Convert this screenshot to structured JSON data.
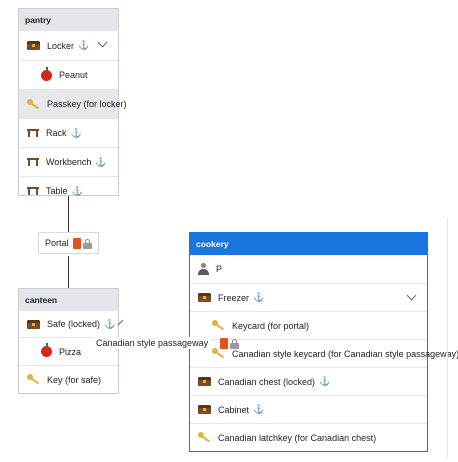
{
  "rooms": {
    "pantry": {
      "title": "pantry",
      "items": [
        {
          "label": "Locker",
          "icon": "chest-icon"
        },
        {
          "label": "Peanut",
          "icon": "apple-icon"
        },
        {
          "label": "Passkey (for locker)",
          "icon": "key-icon"
        },
        {
          "label": "Rack",
          "icon": "table-icon"
        },
        {
          "label": "Workbench",
          "icon": "table-icon"
        },
        {
          "label": "Table",
          "icon": "table-icon"
        }
      ]
    },
    "canteen": {
      "title": "canteen",
      "items": [
        {
          "label": "Safe (locked)",
          "icon": "chest-icon"
        },
        {
          "label": "Pizza",
          "icon": "apple-icon"
        },
        {
          "label": "Key (for safe)",
          "icon": "key-icon"
        }
      ]
    },
    "cookery": {
      "title": "cookery",
      "items": [
        {
          "label": "P",
          "icon": "person-icon"
        },
        {
          "label": "Freezer",
          "icon": "chest-icon"
        },
        {
          "label": "Keycard (for portal)",
          "icon": "key-icon"
        },
        {
          "label": "Canadian style keycard (for Canadian style passageway)",
          "icon": "key-icon"
        },
        {
          "label": "Canadian chest (locked)",
          "icon": "chest-icon"
        },
        {
          "label": "Cabinet",
          "icon": "chest-icon"
        },
        {
          "label": "Canadian latchkey (for Canadian chest)",
          "icon": "key-icon"
        }
      ]
    }
  },
  "connections": {
    "portal": {
      "label": "Portal",
      "icons": [
        "door-icon",
        "lock-icon"
      ]
    },
    "passageway": {
      "label": "Canadian style passageway",
      "icons": [
        "door-icon",
        "lock-icon"
      ]
    }
  },
  "symbols": {
    "anchor": "⚓"
  },
  "colors": {
    "active_header": "#1976e0",
    "inactive_header": "#e2e5ea",
    "highlight_row": "#e6e8eb"
  }
}
